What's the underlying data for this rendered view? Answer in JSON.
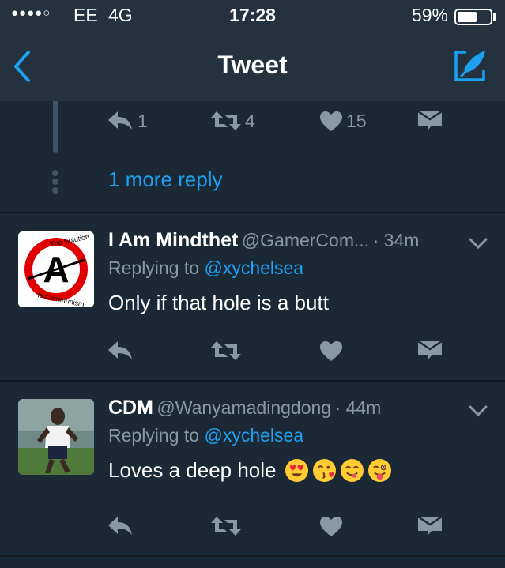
{
  "status_bar": {
    "signal": "●●●●○",
    "carrier": "EE",
    "network": "4G",
    "time": "17:28",
    "battery_percent": "59%",
    "battery_level": 0.59
  },
  "nav": {
    "title": "Tweet",
    "back_icon": "chevron-left-icon",
    "compose_icon": "compose-tweet-icon"
  },
  "colors": {
    "background": "#1b2836",
    "header": "#24313f",
    "accent": "#1da1f2",
    "secondary_text": "#8899a6",
    "icon": "#8899a6",
    "divider": "#10171e"
  },
  "parent_tweet": {
    "reply_count": "1",
    "retweet_count": "4",
    "like_count": "15",
    "more_replies": "1 more reply"
  },
  "replies": [
    {
      "name": "I Am Mindthet",
      "handle": "@GamerCom...",
      "time": "· 34m",
      "replying_prefix": "Replying to",
      "replying_to": "@xychelsea",
      "text": "Only if that hole is a butt",
      "avatar_top_text": "The Solution",
      "avatar_bottom_text": "Is Communism",
      "avatar_letter": "A"
    },
    {
      "name": "CDM",
      "handle": "@Wanyamadingdong",
      "time": "· 44m",
      "replying_prefix": "Replying to",
      "replying_to": "@xychelsea",
      "text": "Loves a deep hole",
      "emojis": [
        "heart-eyes-emoji",
        "face-blowing-kiss-emoji",
        "face-savoring-food-emoji",
        "winking-face-with-tongue-emoji"
      ]
    }
  ]
}
